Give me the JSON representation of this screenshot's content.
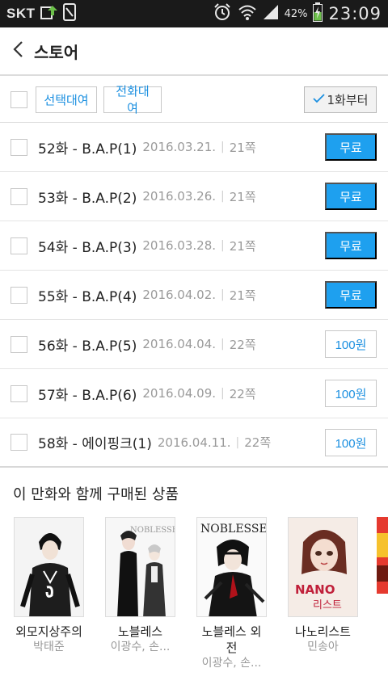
{
  "status_bar": {
    "carrier": "SKT",
    "battery_percent": "42%",
    "time": "23:09"
  },
  "app_bar": {
    "title": "스토어",
    "back_icon": "chevron-left-icon"
  },
  "toolbar": {
    "select_rent_label": "선택대여",
    "rent_all_label": "전화대여",
    "from_first_label": "1화부터"
  },
  "episodes": [
    {
      "title": "52화 - B.A.P(1)",
      "date": "2016.03.21.",
      "pages": "21쪽",
      "price": "무료",
      "free": true
    },
    {
      "title": "53화 - B.A.P(2)",
      "date": "2016.03.26.",
      "pages": "21쪽",
      "price": "무료",
      "free": true
    },
    {
      "title": "54화 - B.A.P(3)",
      "date": "2016.03.28.",
      "pages": "21쪽",
      "price": "무료",
      "free": true
    },
    {
      "title": "55화 - B.A.P(4)",
      "date": "2016.04.02.",
      "pages": "21쪽",
      "price": "무료",
      "free": true
    },
    {
      "title": "56화 - B.A.P(5)",
      "date": "2016.04.04.",
      "pages": "22쪽",
      "price": "100원",
      "free": false
    },
    {
      "title": "57화 - B.A.P(6)",
      "date": "2016.04.09.",
      "pages": "22쪽",
      "price": "100원",
      "free": false
    },
    {
      "title": "58화 - 에이핑크(1)",
      "date": "2016.04.11.",
      "pages": "22쪽",
      "price": "100원",
      "free": false
    }
  ],
  "related": {
    "title": "이 만화와 함께 구매된 상품",
    "books": [
      {
        "title": "외모지상주의",
        "author": "박태준"
      },
      {
        "title": "노블레스",
        "author": "이광수, 손..."
      },
      {
        "title": "노블레스 외전",
        "author": "이광수, 손..."
      },
      {
        "title": "나노리스트",
        "author": "민송아"
      }
    ],
    "cover_texts": [
      "NOBLESSE",
      "NOBLESSE",
      "NANO",
      "리스트"
    ]
  },
  "colors": {
    "accent": "#1ea0ef",
    "status_bar": "#1a1a1a"
  }
}
